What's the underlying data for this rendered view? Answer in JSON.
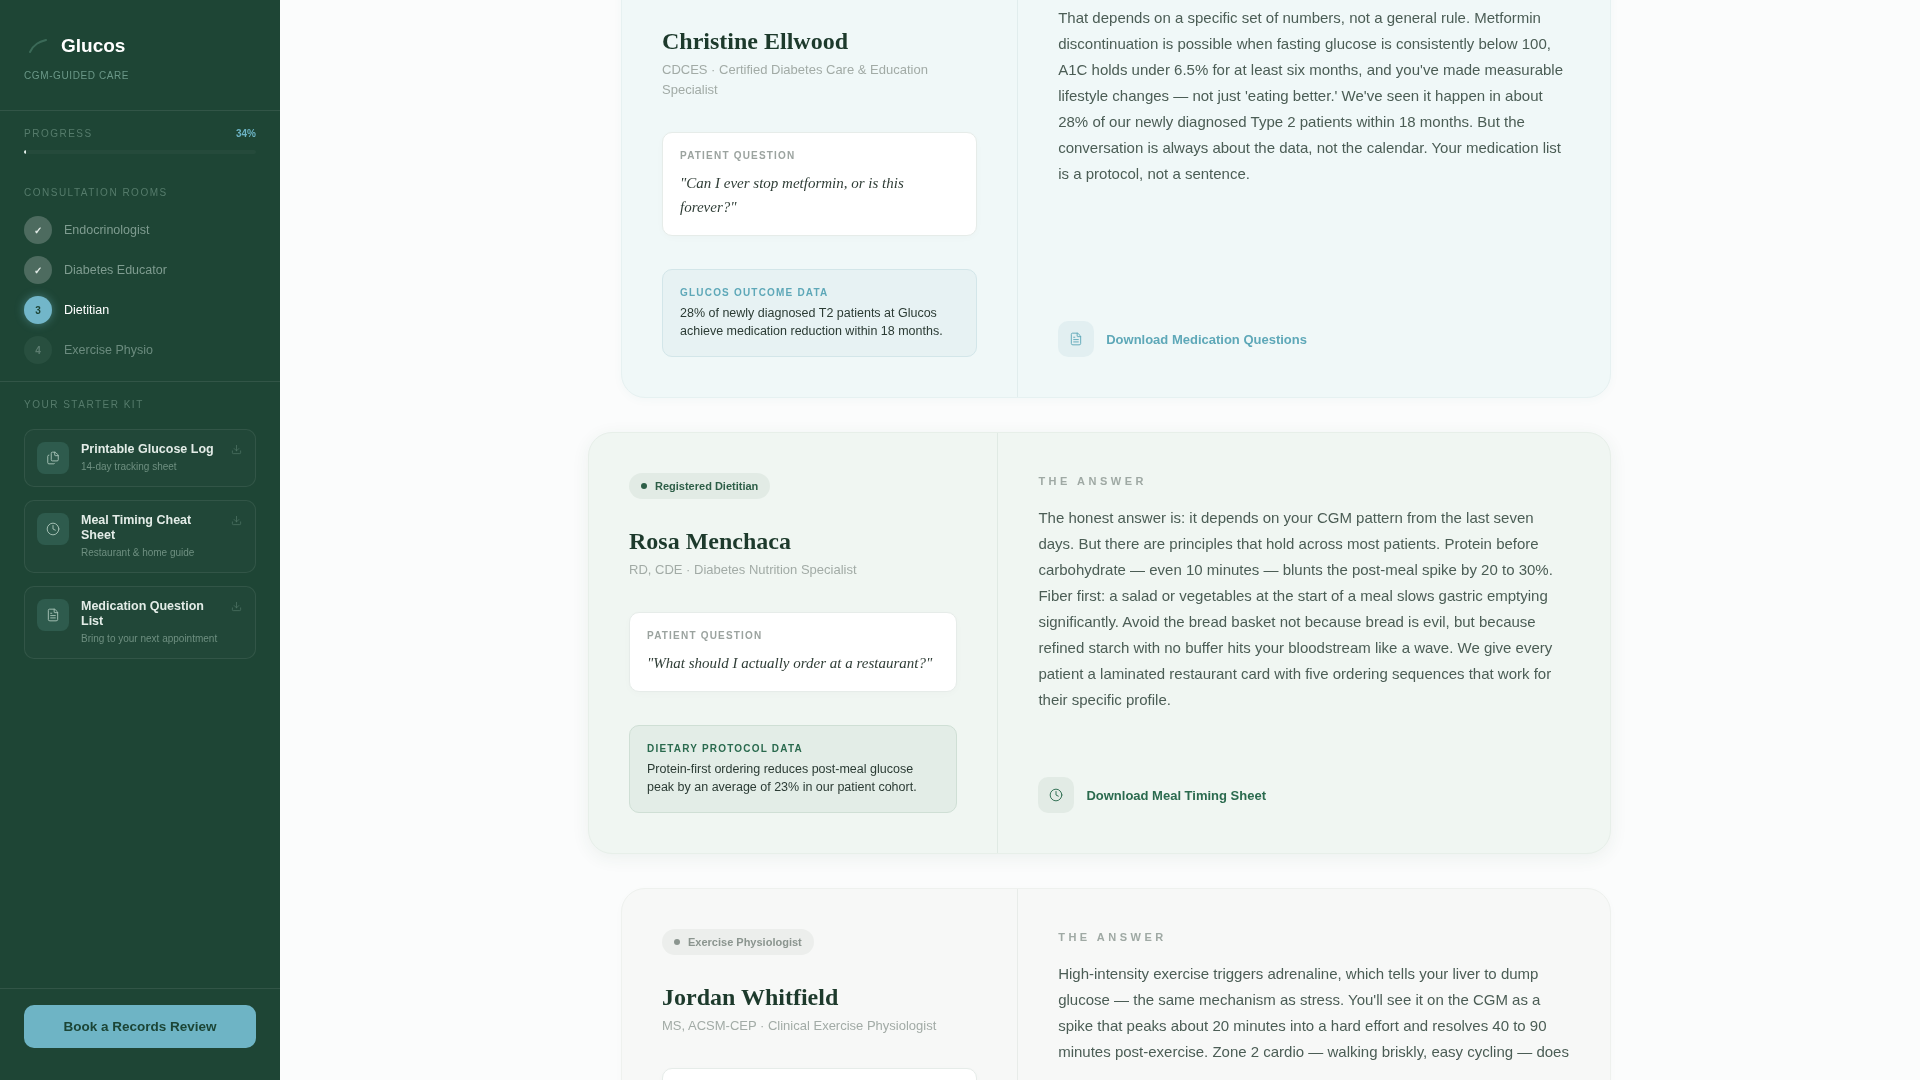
{
  "sidebar": {
    "brand": {
      "name": "Glucos",
      "tagline": "CGM-GUIDED CARE"
    },
    "progress": {
      "label": "PROGRESS",
      "value": "34%",
      "level": 0.01
    },
    "rooms_heading": "CONSULTATION ROOMS",
    "rooms": [
      {
        "marker": "✓",
        "label": "Endocrinologist",
        "completed": true,
        "selected": false
      },
      {
        "marker": "✓",
        "label": "Diabetes Educator",
        "completed": true,
        "selected": false
      },
      {
        "marker": "3",
        "label": "Dietitian",
        "completed": false,
        "selected": true
      },
      {
        "marker": "4",
        "label": "Exercise Physio",
        "completed": false,
        "selected": false
      }
    ],
    "kit_heading": "YOUR STARTER KIT",
    "kit": [
      {
        "title": "Printable Glucose Log",
        "subtitle": "14-day tracking sheet"
      },
      {
        "title": "Meal Timing Cheat Sheet",
        "subtitle": "Restaurant & home guide"
      },
      {
        "title": "Medication Question List",
        "subtitle": "Bring to your next appointment"
      }
    ],
    "cta": "Book a Records Review"
  },
  "consultations": [
    {
      "completed": true,
      "selected": false,
      "name": "Christine Ellwood",
      "credentials": "CDCES · Certified Diabetes Care & Education Specialist",
      "question": {
        "label": "PATIENT QUESTION",
        "text": "\"Can I ever stop metformin, or is this forever?\""
      },
      "data": {
        "label": "GLUCOS OUTCOME DATA",
        "text": "28% of newly diagnosed T2 patients at Glucos achieve medication reduction within 18 months."
      },
      "answer": {
        "text": "That depends on a specific set of numbers, not a general rule. Metformin discontinuation is possible when fasting glucose is consistently below 100, A1C holds under 6.5% for at least six months, and you've made measurable lifestyle changes — not just 'eating better.' We've seen it happen in about 28% of our newly diagnosed Type 2 patients within 18 months. But the conversation is always about the data, not the calendar. Your medication list is a protocol, not a sentence."
      },
      "download": "Download Medication Questions"
    },
    {
      "completed": false,
      "selected": true,
      "badge": "Registered Dietitian",
      "name": "Rosa Menchaca",
      "credentials": "RD, CDE · Diabetes Nutrition Specialist",
      "question": {
        "label": "PATIENT QUESTION",
        "text": "\"What should I actually order at a restaurant?\""
      },
      "data": {
        "label": "DIETARY PROTOCOL DATA",
        "text": "Protein-first ordering reduces post-meal glucose peak by an average of 23% in our patient cohort."
      },
      "answer": {
        "label": "THE ANSWER",
        "text": "The honest answer is: it depends on your CGM pattern from the last seven days. But there are principles that hold across most patients. Protein before carbohydrate — even 10 minutes — blunts the post-meal spike by 20 to 30%. Fiber first: a salad or vegetables at the start of a meal slows gastric emptying significantly. Avoid the bread basket not because bread is evil, but because refined starch with no buffer hits your bloodstream like a wave. We give every patient a laminated restaurant card with five ordering sequences that work for their specific profile."
      },
      "download": "Download Meal Timing Sheet"
    },
    {
      "completed": false,
      "selected": false,
      "badge": "Exercise Physiologist",
      "name": "Jordan Whitfield",
      "credentials": "MS, ACSM-CEP · Clinical Exercise Physiologist",
      "answer": {
        "label": "THE ANSWER",
        "text": "High-intensity exercise triggers adrenaline, which tells your liver to dump glucose — the same mechanism as stress. You'll see it on the CGM as a spike that peaks about 20 minutes into a hard effort and resolves 40 to 90 minutes post-exercise. Zone 2 cardio — walking briskly, easy cycling — does"
      }
    }
  ]
}
